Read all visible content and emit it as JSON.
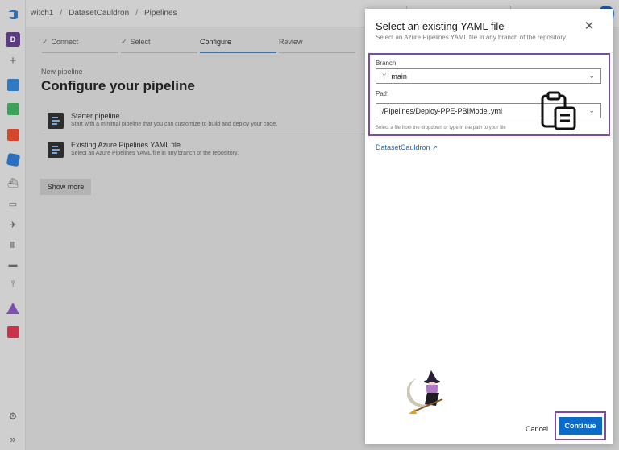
{
  "breadcrumb": {
    "org": "witch1",
    "project": "DatasetCauldron",
    "section": "Pipelines"
  },
  "rail": {
    "project_initial": "D",
    "items": [
      "azure-devops-logo-icon",
      "project-avatar",
      "add-icon",
      "boards-icon",
      "repos-icon",
      "test-plans-icon",
      "pipelines-icon",
      "build-icon",
      "environments-icon",
      "releases-icon",
      "library-icon",
      "task-groups-icon",
      "deployment-groups-icon",
      "artifacts-icon",
      "extensions-icon"
    ],
    "settings": "settings-gear-icon",
    "expand": "expand-chevrons-icon"
  },
  "stepper": [
    {
      "label": "Connect",
      "state": "done"
    },
    {
      "label": "Select",
      "state": "done"
    },
    {
      "label": "Configure",
      "state": "active"
    },
    {
      "label": "Review",
      "state": "pending"
    }
  ],
  "main": {
    "subtitle": "New pipeline",
    "heading": "Configure your pipeline",
    "options": [
      {
        "title": "Starter pipeline",
        "desc": "Start with a minimal pipeline that you can customize to build and deploy your code."
      },
      {
        "title": "Existing Azure Pipelines YAML file",
        "desc": "Select an Azure Pipelines YAML file in any branch of the repository."
      }
    ],
    "show_more": "Show more"
  },
  "panel": {
    "title": "Select an existing YAML file",
    "description": "Select an Azure Pipelines YAML file in any branch of the repository.",
    "branch_label": "Branch",
    "branch_value": "main",
    "path_label": "Path",
    "path_value": "/Pipelines/Deploy-PPE-PBIModel.yml",
    "hint": "Select a file from the dropdown or type in the path to your file",
    "repo_link": "DatasetCauldron",
    "cancel": "Cancel",
    "continue": "Continue"
  },
  "colors": {
    "accent": "#0b6bc6",
    "highlight": "#7c4d9c",
    "link": "#2568b4"
  }
}
